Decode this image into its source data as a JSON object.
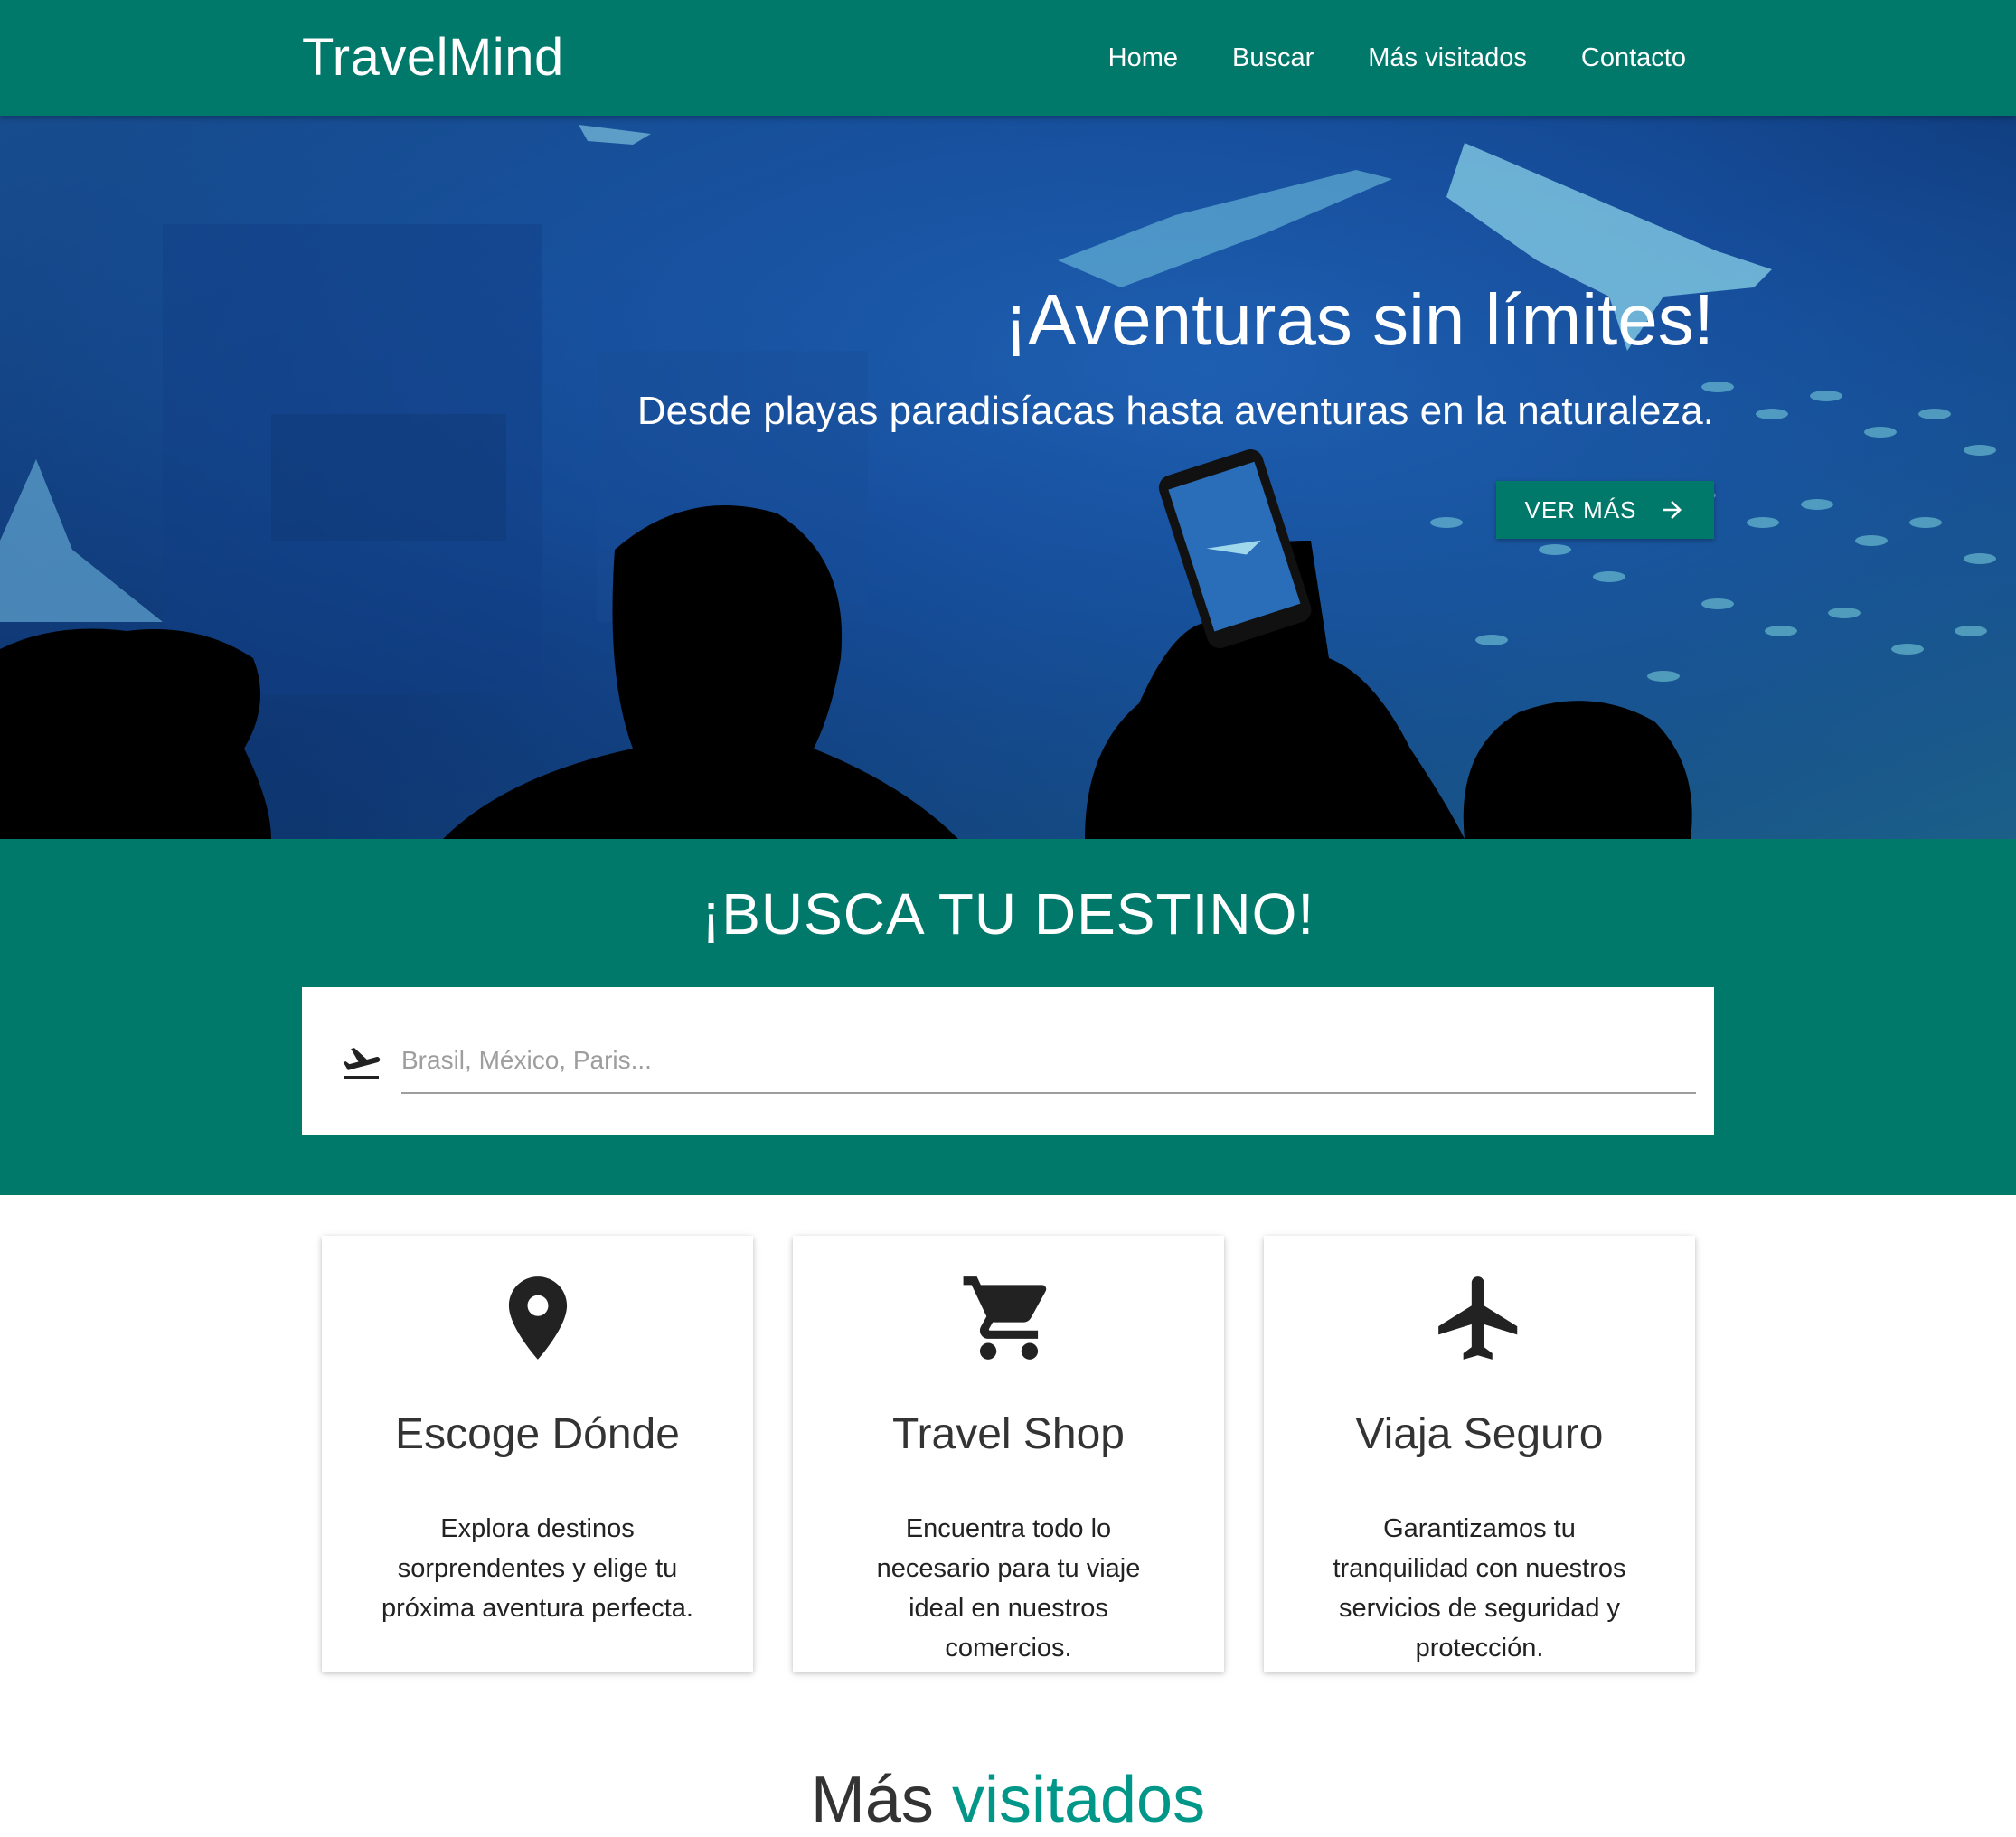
{
  "nav": {
    "brand": "TravelMind",
    "links": [
      "Home",
      "Buscar",
      "Más visitados",
      "Contacto"
    ]
  },
  "hero": {
    "title": "¡Aventuras sin límites!",
    "subtitle": "Desde playas paradisíacas hasta aventuras en la naturaleza.",
    "button_label": "VER MÁS",
    "button_icon": "arrow-right-icon"
  },
  "search": {
    "title": "¡BUSCA TU DESTINO!",
    "placeholder": "Brasil, México, Paris...",
    "value": "",
    "icon": "flight-takeoff-icon"
  },
  "features": [
    {
      "icon": "location-pin-icon",
      "title": "Escoge Dónde",
      "text": "Explora destinos sorprendentes y elige tu próxima aventura perfecta."
    },
    {
      "icon": "shopping-cart-icon",
      "title": "Travel Shop",
      "text": "Encuentra todo lo necesario para tu viaje ideal en nuestros comercios."
    },
    {
      "icon": "airplane-icon",
      "title": "Viaja Seguro",
      "text": "Garantizamos tu tranquilidad con nuestros servicios de seguridad y protección."
    }
  ],
  "popular": {
    "title_part1": "Más",
    "title_part2": "visitados"
  },
  "colors": {
    "primary": "#00796b",
    "accent": "#009688",
    "hero_blue": "#154a97"
  }
}
